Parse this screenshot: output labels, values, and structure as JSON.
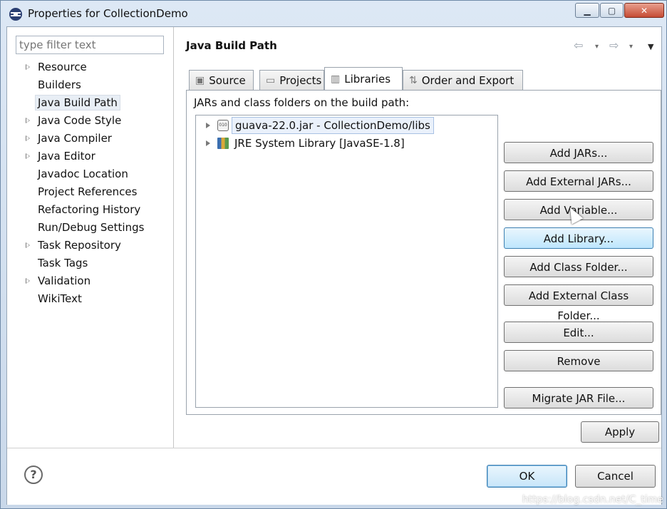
{
  "window": {
    "title": "Properties for CollectionDemo",
    "minimize_glyph": "▁",
    "maximize_glyph": "▢",
    "close_glyph": "✕"
  },
  "filter": {
    "placeholder": "type filter text"
  },
  "nav": {
    "items": [
      {
        "label": "Resource",
        "expandable": true
      },
      {
        "label": "Builders",
        "expandable": false
      },
      {
        "label": "Java Build Path",
        "expandable": false,
        "selected": true
      },
      {
        "label": "Java Code Style",
        "expandable": true
      },
      {
        "label": "Java Compiler",
        "expandable": true
      },
      {
        "label": "Java Editor",
        "expandable": true
      },
      {
        "label": "Javadoc Location",
        "expandable": false
      },
      {
        "label": "Project References",
        "expandable": false
      },
      {
        "label": "Refactoring History",
        "expandable": false
      },
      {
        "label": "Run/Debug Settings",
        "expandable": false
      },
      {
        "label": "Task Repository",
        "expandable": true
      },
      {
        "label": "Task Tags",
        "expandable": false
      },
      {
        "label": "Validation",
        "expandable": true
      },
      {
        "label": "WikiText",
        "expandable": false
      }
    ]
  },
  "page": {
    "title": "Java Build Path",
    "history": {
      "back": "⇦",
      "forward": "⇨",
      "dropdown": "▾",
      "menu": "▼"
    }
  },
  "tabs": [
    {
      "label": "Source",
      "icon": "source-folder-icon",
      "glyph": "▣"
    },
    {
      "label": "Projects",
      "icon": "projects-folder-icon",
      "glyph": "▭"
    },
    {
      "label": "Libraries",
      "icon": "libraries-icon",
      "glyph": "▥",
      "active": true
    },
    {
      "label": "Order and Export",
      "icon": "order-export-icon",
      "glyph": "⇅"
    }
  ],
  "libraries": {
    "caption": "JARs and class folders on the build path:",
    "entries": [
      {
        "label": "guava-22.0.jar - CollectionDemo/libs",
        "icon": "jar-icon",
        "icon_text": "010",
        "selected": true
      },
      {
        "label": "JRE System Library [JavaSE-1.8]",
        "icon": "library-icon",
        "selected": false
      }
    ],
    "buttons": [
      "Add JARs...",
      "Add External JARs...",
      "Add Variable...",
      "Add Library...",
      "Add Class Folder...",
      "Add External Class Folder...",
      "Edit...",
      "Remove",
      "Migrate JAR File..."
    ]
  },
  "actions": {
    "apply": "Apply",
    "ok": "OK",
    "cancel": "Cancel",
    "help_glyph": "?"
  },
  "watermark": "https://blog.csdn.net/C_time",
  "colors": {
    "selection_bg": "#eaf1fb",
    "ok_border": "#3c7fb1"
  }
}
